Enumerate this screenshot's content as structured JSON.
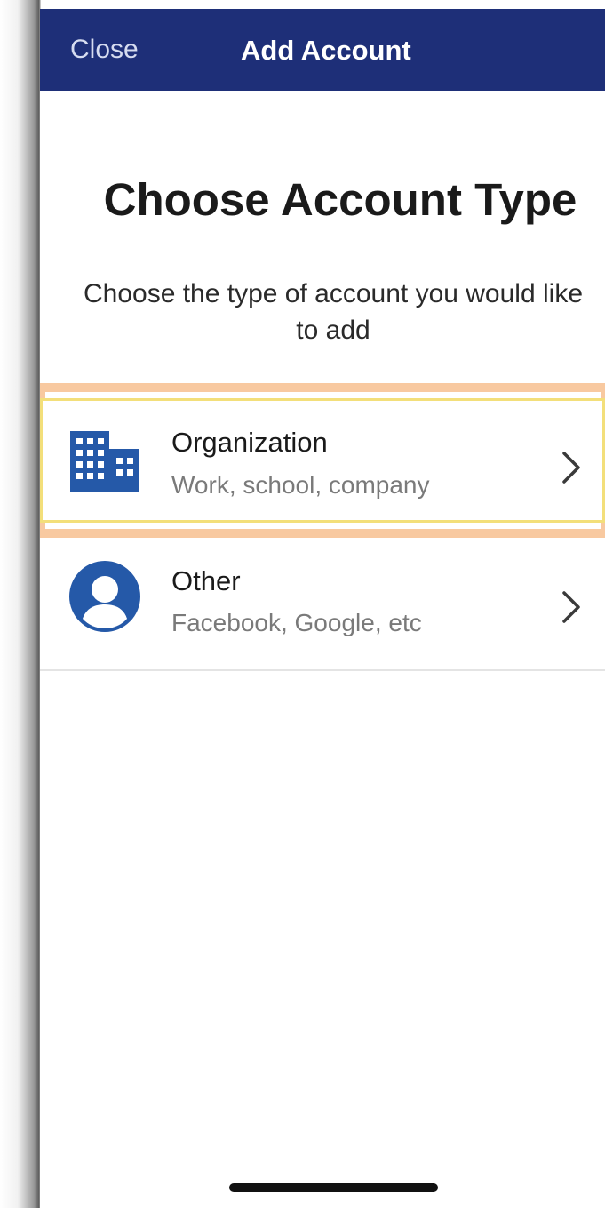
{
  "navbar": {
    "close_label": "Close",
    "title": "Add Account"
  },
  "main": {
    "heading": "Choose Account Type",
    "subtitle": "Choose the type of account you would like to add"
  },
  "account_types": [
    {
      "title": "Organization",
      "subtitle": "Work, school, company",
      "icon": "building-icon",
      "highlighted": true
    },
    {
      "title": "Other",
      "subtitle": "Facebook, Google, etc",
      "icon": "user-circle-icon",
      "highlighted": false
    }
  ],
  "colors": {
    "navbar": "#1e2f78",
    "icon": "#2559a8",
    "highlight": "#f8c9a0"
  }
}
